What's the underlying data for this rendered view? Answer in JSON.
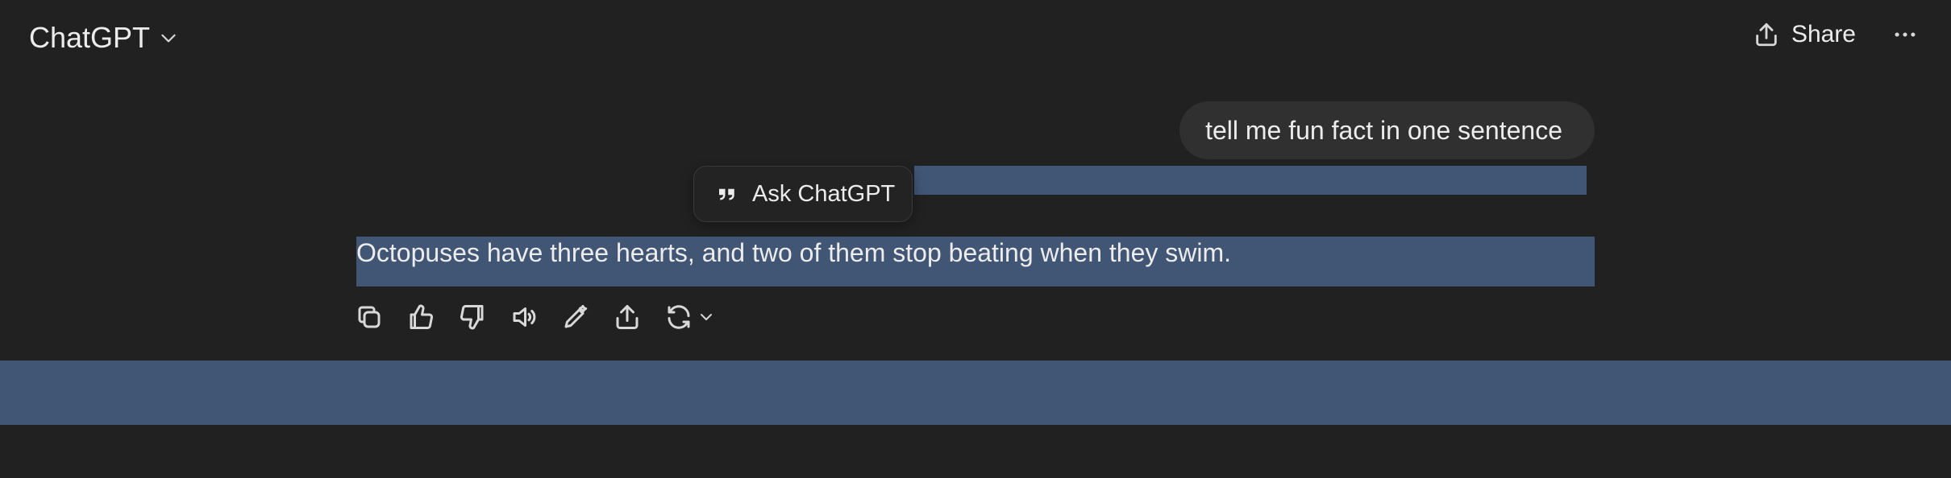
{
  "header": {
    "title": "ChatGPT",
    "share_label": "Share"
  },
  "conversation": {
    "user_message": "tell me fun fact in one sentence",
    "assistant_message": "Octopuses have three hearts, and two of them stop beating when they swim."
  },
  "selection_popup": {
    "label": "Ask ChatGPT"
  },
  "icons": {
    "title_chevron": "chevron-down-icon",
    "share": "share-icon",
    "more": "more-horizontal-icon",
    "quote": "quote-icon",
    "copy": "copy-icon",
    "thumbs_up": "thumbs-up-icon",
    "thumbs_down": "thumbs-down-icon",
    "read_aloud": "speaker-icon",
    "edit": "edit-pencil-icon",
    "share_response": "share-icon",
    "regenerate": "refresh-icon"
  },
  "colors": {
    "background": "#212121",
    "user_bubble": "#303030",
    "selection_highlight": "#415574",
    "text": "#ececec"
  }
}
